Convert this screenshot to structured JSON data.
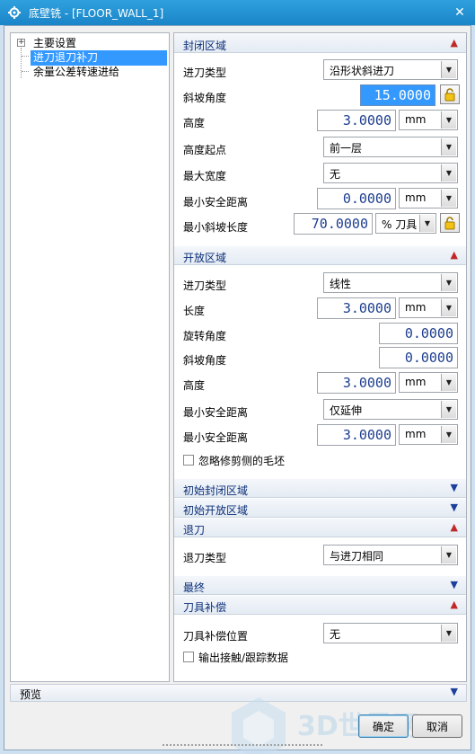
{
  "window": {
    "title": "底壁铣 - [FLOOR_WALL_1]",
    "close_icon": "close-icon",
    "app_icon": "gear-icon"
  },
  "tree": {
    "items": [
      {
        "label": "主要设置",
        "expander": "+"
      },
      {
        "label": "进刀退刀补刀"
      },
      {
        "label": "余量公差转速进给"
      }
    ]
  },
  "sections": {
    "closed": {
      "title": "封闭区域",
      "rows": {
        "entry_type": {
          "label": "进刀类型",
          "value": "沿形状斜进刀"
        },
        "ramp_angle": {
          "label": "斜坡角度",
          "value": "15.0000"
        },
        "height": {
          "label": "高度",
          "value": "3.0000",
          "unit": "mm"
        },
        "height_from": {
          "label": "高度起点",
          "value": "前一层"
        },
        "max_width": {
          "label": "最大宽度",
          "value": "无"
        },
        "min_clearance": {
          "label": "最小安全距离",
          "value": "0.0000",
          "unit": "mm"
        },
        "min_ramp_len": {
          "label": "最小斜坡长度",
          "value": "70.0000",
          "unit": "% 刀具"
        }
      }
    },
    "open": {
      "title": "开放区域",
      "rows": {
        "entry_type": {
          "label": "进刀类型",
          "value": "线性"
        },
        "length": {
          "label": "长度",
          "value": "3.0000",
          "unit": "mm"
        },
        "rotation": {
          "label": "旋转角度",
          "value": "0.0000"
        },
        "ramp_angle": {
          "label": "斜坡角度",
          "value": "0.0000"
        },
        "height": {
          "label": "高度",
          "value": "3.0000",
          "unit": "mm"
        },
        "min_clearance_1": {
          "label": "最小安全距离",
          "value": "仅延伸"
        },
        "min_clearance_2": {
          "label": "最小安全距离",
          "value": "3.0000",
          "unit": "mm"
        },
        "ignore_blank": {
          "label": "忽略修剪侧的毛坯"
        }
      }
    },
    "init_closed": {
      "title": "初始封闭区域"
    },
    "init_open": {
      "title": "初始开放区域"
    },
    "retract": {
      "title": "退刀",
      "rows": {
        "type": {
          "label": "退刀类型",
          "value": "与进刀相同"
        }
      }
    },
    "final": {
      "title": "最终"
    },
    "cutcomp": {
      "title": "刀具补偿",
      "rows": {
        "position": {
          "label": "刀具补偿位置",
          "value": "无"
        },
        "output": {
          "label": "输出接触/跟踪数据"
        }
      }
    }
  },
  "preview": {
    "label": "预览"
  },
  "buttons": {
    "ok": "确定",
    "cancel": "取消"
  },
  "watermark": {
    "text": "3D世界网"
  },
  "colors": {
    "titlebar": "#1a85c8",
    "header_text": "#0c2f79",
    "value_text": "#1d3e8f",
    "selection": "#3399ff",
    "collapse_red": "#c0282a"
  }
}
